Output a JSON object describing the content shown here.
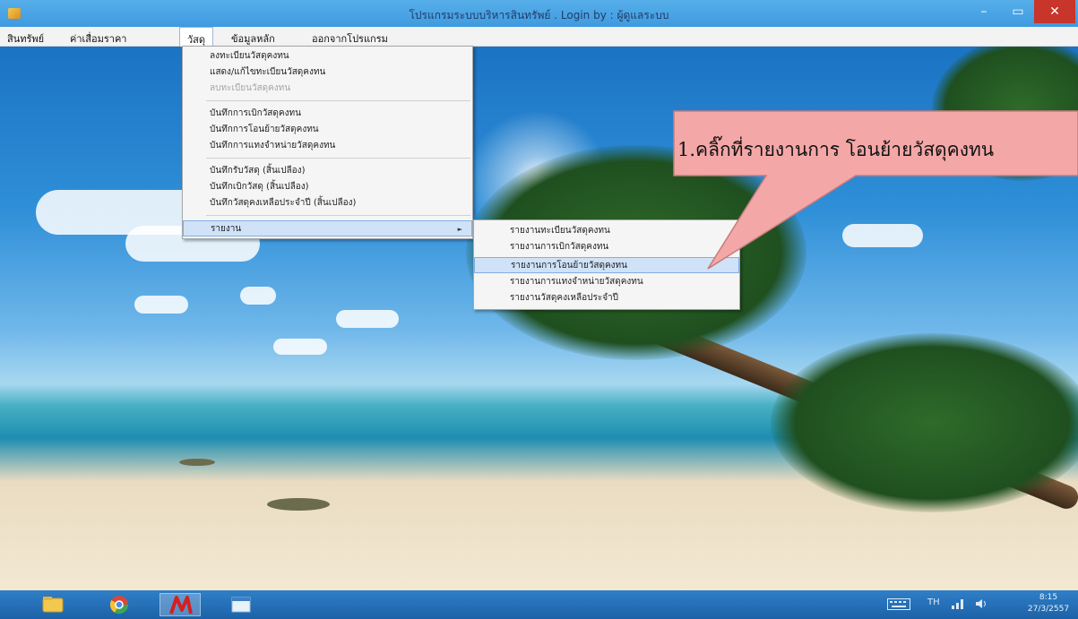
{
  "window": {
    "title": "โปรแกรมระบบบริหารสินทรัพย์ . Login by : ผู้ดูแลระบบ",
    "minimize_glyph": "–",
    "maximize_glyph": "▭",
    "close_glyph": "✕"
  },
  "menubar": {
    "items": [
      "สินทรัพย์",
      "ค่าเสื่อมราคา",
      "วัสดุ",
      "ข้อมูลหลัก",
      "ออกจากโปรแกรม"
    ],
    "active_index": 2
  },
  "dropdown": {
    "groups": [
      [
        "ลงทะเบียนวัสดุคงทน",
        "แสดง/แก้ไขทะเบียนวัสดุคงทน",
        "ลบทะเบียนวัสดุคงทน"
      ],
      [
        "บันทึกการเบิกวัสดุคงทน",
        "บันทึกการโอนย้ายวัสดุคงทน",
        "บันทึกการแทงจำหน่ายวัสดุคงทน"
      ],
      [
        "บันทึกรับวัสดุ (สิ้นเปลือง)",
        "บันทึกเบิกวัสดุ (สิ้นเปลือง)",
        "บันทึกวัสดุคงเหลือประจำปี (สิ้นเปลือง)"
      ],
      [
        "รายงาน"
      ]
    ],
    "disabled_item": "ลบทะเบียนวัสดุคงทน",
    "submenu_parent": "รายงาน",
    "submenu_arrow": "►"
  },
  "submenu": {
    "items": [
      "รายงานทะเบียนวัสดุคงทน",
      "รายงานการเบิกวัสดุคงทน",
      "รายงานการโอนย้ายวัสดุคงทน",
      "รายงานการแทงจำหน่ายวัสดุคงทน",
      "รายงานวัสดุคงเหลือประจำปี"
    ],
    "highlighted_index": 2
  },
  "callout": {
    "text": "1.คลิ๊กที่รายงานการ โอนย้ายวัสดุคงทน",
    "fill_color": "#f4a7a7",
    "border_color": "#c77b7b"
  },
  "taskbar": {
    "apps": [
      "file-explorer-icon",
      "chrome-icon",
      "asset-program-icon",
      "window-app-icon"
    ],
    "active_app": "asset-program-icon",
    "keyboard_label": "TH",
    "clock_time": "8:15",
    "clock_date": "27/3/2557"
  },
  "colors": {
    "titlebar": "#4aa3e6",
    "menu_highlight": "#d0e2f7",
    "close_button": "#c7352b",
    "taskbar": "#2571b8"
  }
}
